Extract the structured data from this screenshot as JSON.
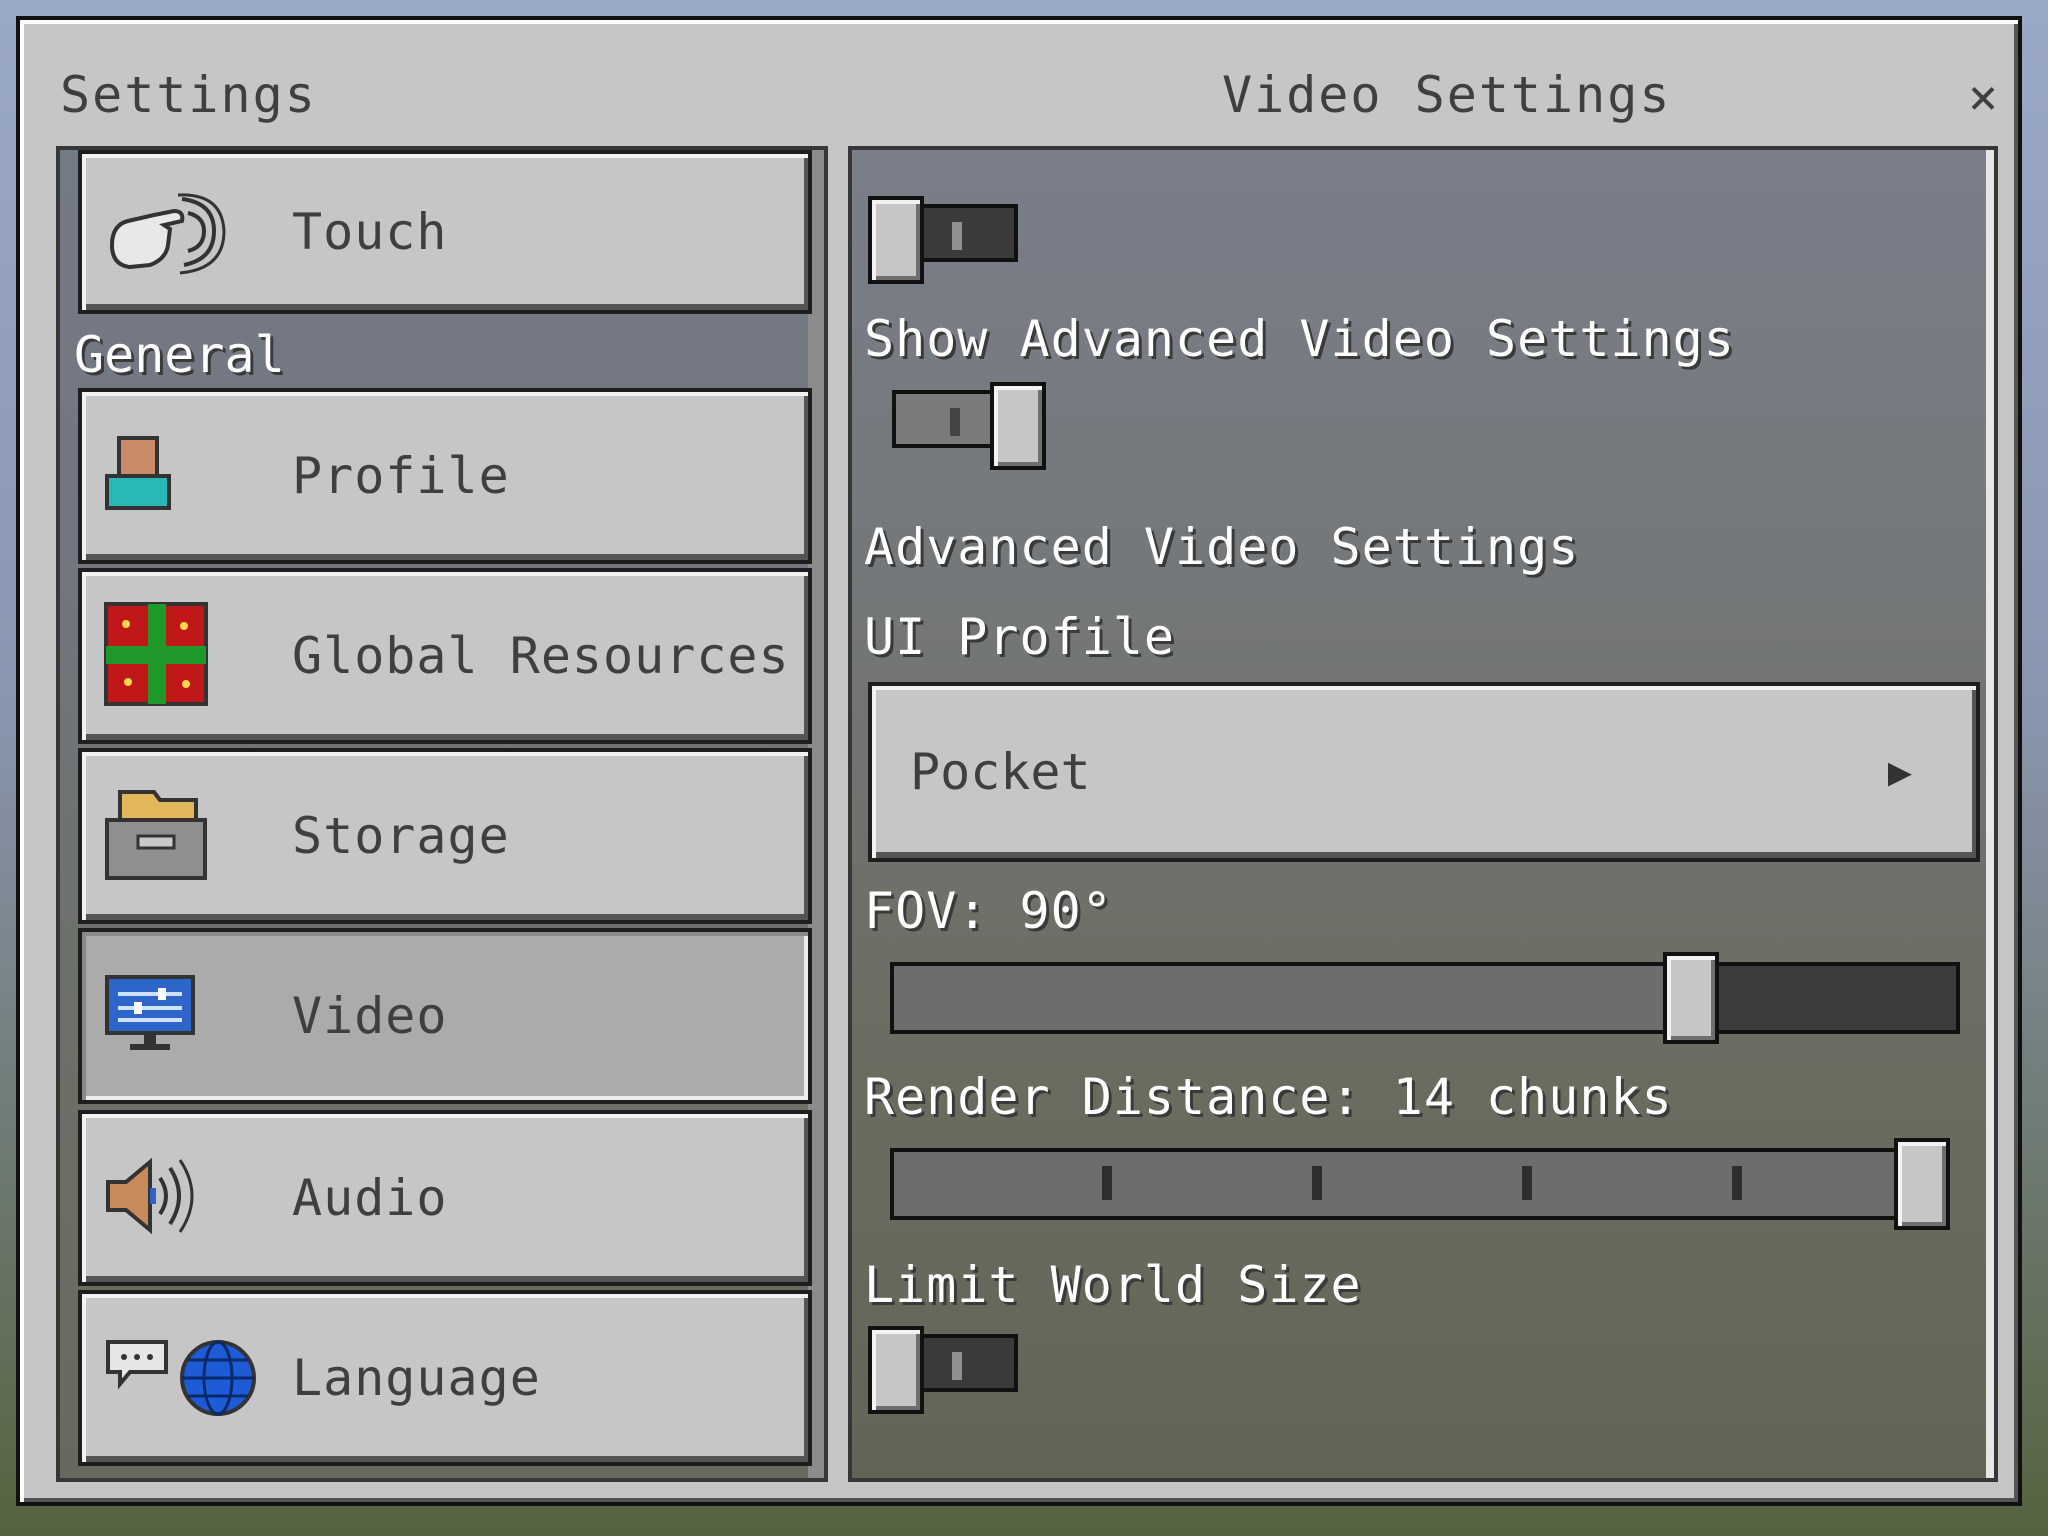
{
  "window": {
    "left_title": "Settings",
    "right_title": "Video Settings",
    "close_glyph": "×"
  },
  "sidebar": {
    "section_general": "General",
    "items": [
      {
        "label": "Touch",
        "icon": "touch-hand-icon",
        "active": false
      },
      {
        "label": "Profile",
        "icon": "profile-person-icon",
        "active": false
      },
      {
        "label": "Global Resources",
        "icon": "resource-pack-icon",
        "active": false
      },
      {
        "label": "Storage",
        "icon": "storage-folder-icon",
        "active": false
      },
      {
        "label": "Video",
        "icon": "video-monitor-icon",
        "active": true
      },
      {
        "label": "Audio",
        "icon": "speaker-icon",
        "active": false
      },
      {
        "label": "Language",
        "icon": "language-globe-icon",
        "active": false
      }
    ]
  },
  "video": {
    "top_toggle": {
      "on": false
    },
    "show_advanced_label": "Show Advanced Video Settings",
    "show_advanced_toggle": {
      "on": true
    },
    "advanced_header": "Advanced Video Settings",
    "ui_profile_label": "UI Profile",
    "ui_profile_value": "Pocket",
    "fov_label": "FOV: 90°",
    "fov_fraction": 0.75,
    "render_distance_label": "Render Distance: 14 chunks",
    "render_distance_fraction": 1.0,
    "limit_world_label": "Limit World Size",
    "limit_world_toggle": {
      "on": false
    }
  },
  "colors": {
    "panel": "#c6c6c6",
    "dark_border": "#1e1e1e",
    "text": "#3f3f3f"
  }
}
